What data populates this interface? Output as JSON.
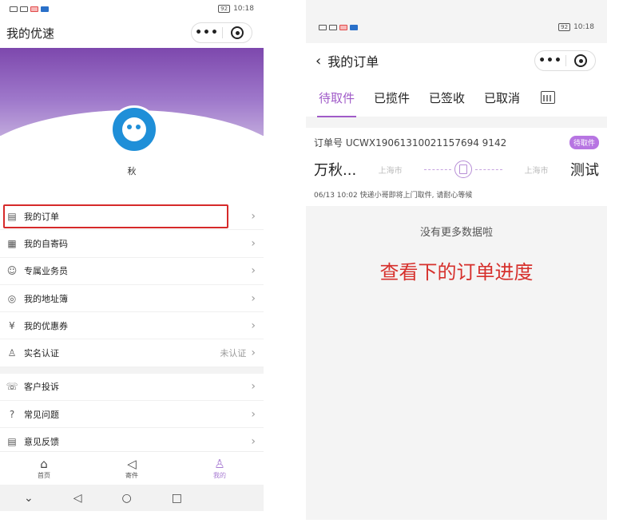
{
  "left_phone": {
    "status_time": "10:18",
    "battery": "92",
    "title": "我的优速",
    "nickname": "秋",
    "menu_group_1": [
      {
        "label": "我的订单",
        "icon": "order-list-icon",
        "extra": ""
      },
      {
        "label": "我的自寄码",
        "icon": "qr-code-icon",
        "extra": ""
      },
      {
        "label": "专属业务员",
        "icon": "person-icon",
        "extra": ""
      },
      {
        "label": "我的地址簿",
        "icon": "location-icon",
        "extra": ""
      },
      {
        "label": "我的优惠券",
        "icon": "coupon-icon",
        "extra": ""
      },
      {
        "label": "实名认证",
        "icon": "verify-icon",
        "extra": "未认证"
      }
    ],
    "menu_group_2": [
      {
        "label": "客户投诉",
        "icon": "complaint-icon"
      },
      {
        "label": "常见问题",
        "icon": "question-icon"
      },
      {
        "label": "意见反馈",
        "icon": "feedback-icon"
      }
    ],
    "tabbar": [
      {
        "label": "首页",
        "icon": "home-icon"
      },
      {
        "label": "寄件",
        "icon": "send-icon"
      },
      {
        "label": "我的",
        "icon": "profile-icon",
        "active": true
      }
    ]
  },
  "right_phone": {
    "status_time": "10:18",
    "battery": "92",
    "title": "我的订单",
    "tabs": [
      "待取件",
      "已揽件",
      "已签收",
      "已取消"
    ],
    "active_tab": "待取件",
    "order": {
      "number_label": "订单号 UCWX19061310021157694 9142",
      "status_badge": "待取件",
      "sender": "万秋...",
      "sender_city": "上海市",
      "receiver_city": "上海市",
      "receiver": "测试",
      "status_line": "06/13 10:02  快递小哥即将上门取件, 请耐心等候"
    },
    "no_more_text": "没有更多数据啦",
    "annotation": "查看下的订单进度"
  },
  "colors": {
    "accent_purple": "#a05bc8",
    "highlight_red": "#d62a2a",
    "annotation_red": "#d6302c"
  }
}
